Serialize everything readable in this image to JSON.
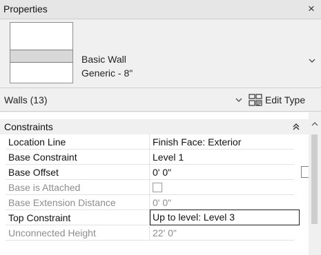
{
  "window": {
    "title": "Properties",
    "close_glyph": "×"
  },
  "type_selector": {
    "family": "Basic Wall",
    "type": "Generic - 8\""
  },
  "filter": {
    "label": "Walls (13)",
    "edit_type_label": "Edit Type"
  },
  "group": {
    "label": "Constraints"
  },
  "properties": [
    {
      "name": "Location Line",
      "value": "Finish Face: Exterior",
      "enabled": true
    },
    {
      "name": "Base Constraint",
      "value": "Level 1",
      "enabled": true
    },
    {
      "name": "Base Offset",
      "value": "0'  0\"",
      "enabled": true
    },
    {
      "name": "Base is Attached",
      "value": "",
      "enabled": false,
      "checked": false
    },
    {
      "name": "Base Extension Distance",
      "value": "0'  0\"",
      "enabled": false
    },
    {
      "name": "Top Constraint",
      "value": "Up to level: Level 3",
      "enabled": true,
      "active": true
    },
    {
      "name": "Unconnected Height",
      "value": "22'  0\"",
      "enabled": false
    }
  ],
  "colors": {
    "panel_bg": "#f0f0f0",
    "grid_bg": "#ffffff",
    "disabled_text": "#8d8d8d",
    "header_bg": "#e6e6e6"
  },
  "icons": {
    "close": "close-icon",
    "dropdown": "chevron-down-icon",
    "edit_type": "edit-type-icon",
    "collapse": "double-chevron-up-icon",
    "scroll_up": "scroll-up-arrow-icon"
  }
}
